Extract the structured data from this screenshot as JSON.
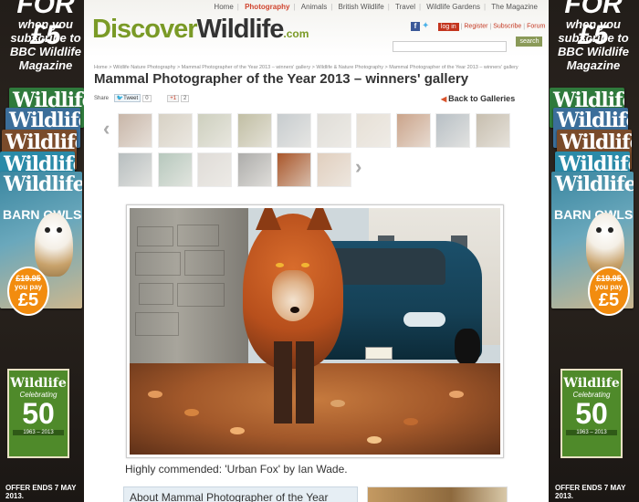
{
  "ad": {
    "for_text": "FOR £5",
    "line1": "when you",
    "line2": "subscribe to",
    "line3": "BBC Wildlife",
    "line4": "Magazine",
    "mag_title": "Wildlife",
    "cover_headline": "BARN OWLS",
    "price_was": "£19.95",
    "price_pay": "you pay",
    "price_now": "£5",
    "celebrate_title": "Wildlife",
    "celebrate_sub": "Celebrating",
    "celebrate_num": "50",
    "celebrate_years": "1963 – 2013",
    "offer_text": "OFFER ENDS 7 MAY 2013."
  },
  "header": {
    "nav": [
      "Home",
      "Photography",
      "Animals",
      "British Wildlife",
      "Travel",
      "Wildlife Gardens",
      "The Magazine"
    ],
    "active_nav": "Photography",
    "logo_part1": "Discover",
    "logo_part2": "Wildlife",
    "logo_part3": ".com",
    "login_label": "log in",
    "register_label": "Register",
    "subscribe_label": "Subscribe",
    "forum_label": "Forum",
    "search_placeholder": "",
    "search_button": "search"
  },
  "breadcrumb": "Home > Wildlife Nature Photography > Mammal Photographer of the Year 2013 – winners' gallery > Wildlife & Nature Photography > Mammal Photographer of the Year 2013 – winners' gallery",
  "title": "Mammal Photographer of the Year 2013 – winners' gallery",
  "share": {
    "label": "Share",
    "tweet_label": "Tweet",
    "tweet_count": "0",
    "gplus_label": "+1",
    "gplus_count": "2"
  },
  "back_link": "Back to Galleries",
  "thumbnails_row1": [
    "#9c7b62",
    "#b8ad96",
    "#a6a98a",
    "#8f8a5a",
    "#9aa3a8",
    "#c7c2b8",
    "#d3c7b6",
    "#a05a2c",
    "#7e8c96",
    "#9a8a6e"
  ],
  "thumbnails_row2": [
    "#7d8a8c",
    "#7c9c88",
    "#c6c0b8",
    "#6b6a66",
    "#a9562a",
    "#c8a88a"
  ],
  "caption": "Highly commended: 'Urban Fox' by Ian Wade.",
  "about_heading": "About Mammal Photographer of the Year"
}
